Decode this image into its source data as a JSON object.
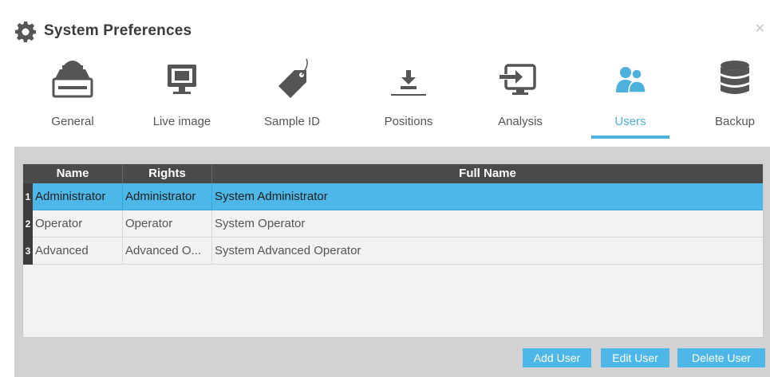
{
  "window": {
    "title": "System Preferences",
    "title_icon": "gear-icon",
    "close_icon": "close-icon"
  },
  "tabs": [
    {
      "label": "General",
      "icon": "general-machine-icon",
      "active": false
    },
    {
      "label": "Live image",
      "icon": "monitor-icon",
      "active": false
    },
    {
      "label": "Sample ID",
      "icon": "tag-icon",
      "active": false
    },
    {
      "label": "Positions",
      "icon": "download-tray-icon",
      "active": false
    },
    {
      "label": "Analysis",
      "icon": "analysis-export-icon",
      "active": false
    },
    {
      "label": "Users",
      "icon": "users-icon",
      "active": true
    },
    {
      "label": "Backup",
      "icon": "database-icon",
      "active": false
    }
  ],
  "accent_color": "#4db8e8",
  "table": {
    "columns": [
      "Name",
      "Rights",
      "Full Name"
    ],
    "rows": [
      {
        "num": "1",
        "name": "Administrator",
        "rights": "Administrator",
        "full_name": "System Administrator",
        "selected": true
      },
      {
        "num": "2",
        "name": "Operator",
        "rights": "Operator",
        "full_name": "System Operator",
        "selected": false
      },
      {
        "num": "3",
        "name": "Advanced",
        "rights": "Advanced O...",
        "full_name": "System Advanced Operator",
        "selected": false
      }
    ]
  },
  "buttons": {
    "add": "Add User",
    "edit": "Edit User",
    "delete": "Delete User"
  }
}
